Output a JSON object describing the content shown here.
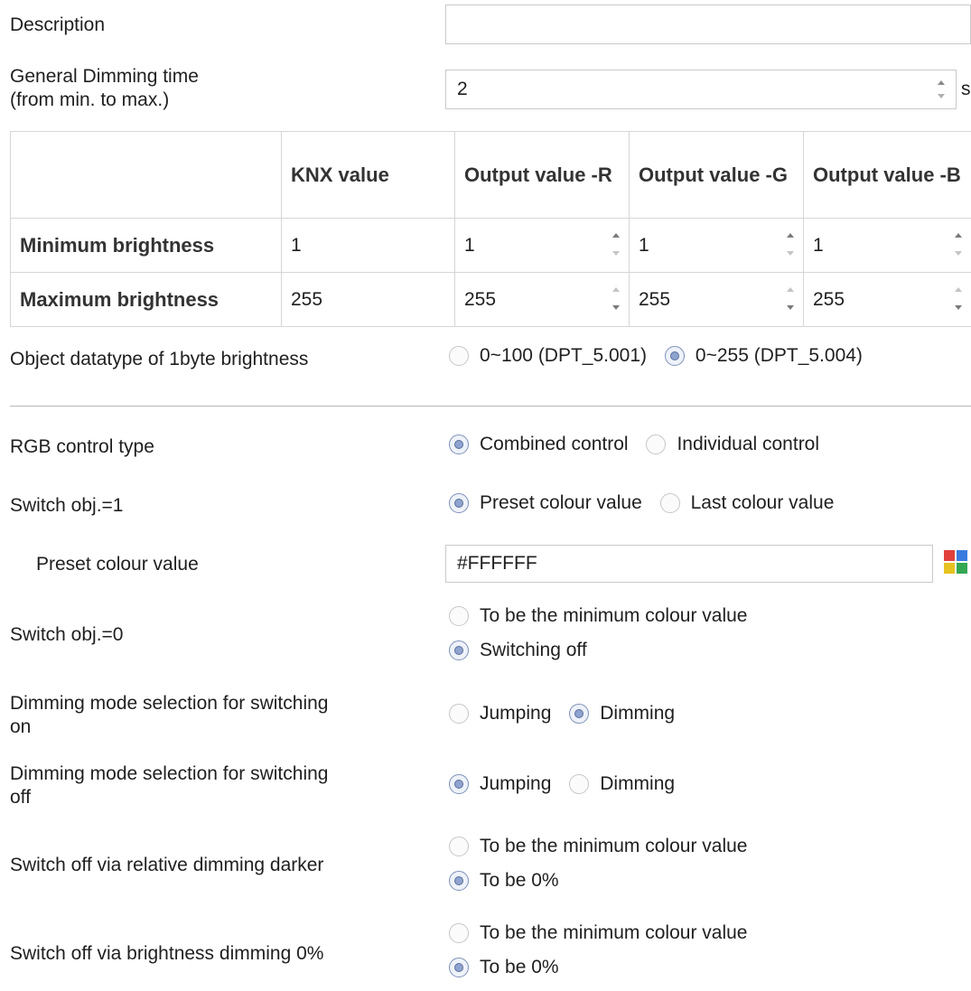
{
  "description": {
    "label": "Description",
    "value": ""
  },
  "dimming_time": {
    "label_line1": "General Dimming  time",
    "label_line2": "(from min. to max.)",
    "value": "2",
    "unit": "s"
  },
  "brightness_table": {
    "headers": [
      "",
      "KNX value",
      "Output value -R",
      "Output value -G",
      "Output value -B"
    ],
    "rows": [
      {
        "label": "Minimum brightness",
        "values": [
          "1",
          "1",
          "1",
          "1"
        ]
      },
      {
        "label": "Maximum brightness",
        "values": [
          "255",
          "255",
          "255",
          "255"
        ]
      }
    ]
  },
  "datatype": {
    "label": "Object datatype of 1byte brightness",
    "options": [
      "0~100 (DPT_5.001)",
      "0~255 (DPT_5.004)"
    ],
    "selected": 1
  },
  "rgb_control": {
    "label": "RGB control type",
    "options": [
      "Combined control",
      "Individual control"
    ],
    "selected": 0
  },
  "switch_on": {
    "label": "Switch obj.=1",
    "options": [
      "Preset colour value",
      "Last colour value"
    ],
    "selected": 0
  },
  "preset_colour": {
    "label": "Preset colour value",
    "value": "#FFFFFF"
  },
  "switch_off": {
    "label": "Switch obj.=0",
    "options": [
      "To be the minimum colour value",
      "Switching off"
    ],
    "selected": 1
  },
  "dim_on": {
    "label_line1": "Dimming  mode selection for switching",
    "label_line2": "on",
    "options": [
      "Jumping",
      "Dimming"
    ],
    "selected": 1
  },
  "dim_off": {
    "label_line1": "Dimming  mode selection for switching",
    "label_line2": "off",
    "options": [
      "Jumping",
      "Dimming"
    ],
    "selected": 0
  },
  "rel_dim": {
    "label": "Switch off via relative dimming darker",
    "options": [
      "To be the minimum colour value",
      "To be 0%"
    ],
    "selected": 1
  },
  "bright_dim": {
    "label": "Switch off via brightness dimming 0%",
    "options": [
      "To be the minimum colour value",
      "To be 0%"
    ],
    "selected": 1
  },
  "colors": {
    "radio_selected": "#8ea3cf",
    "border": "#d6d6d6",
    "palette": [
      "#e0413a",
      "#3a7be0",
      "#e8c221",
      "#34a853"
    ]
  }
}
